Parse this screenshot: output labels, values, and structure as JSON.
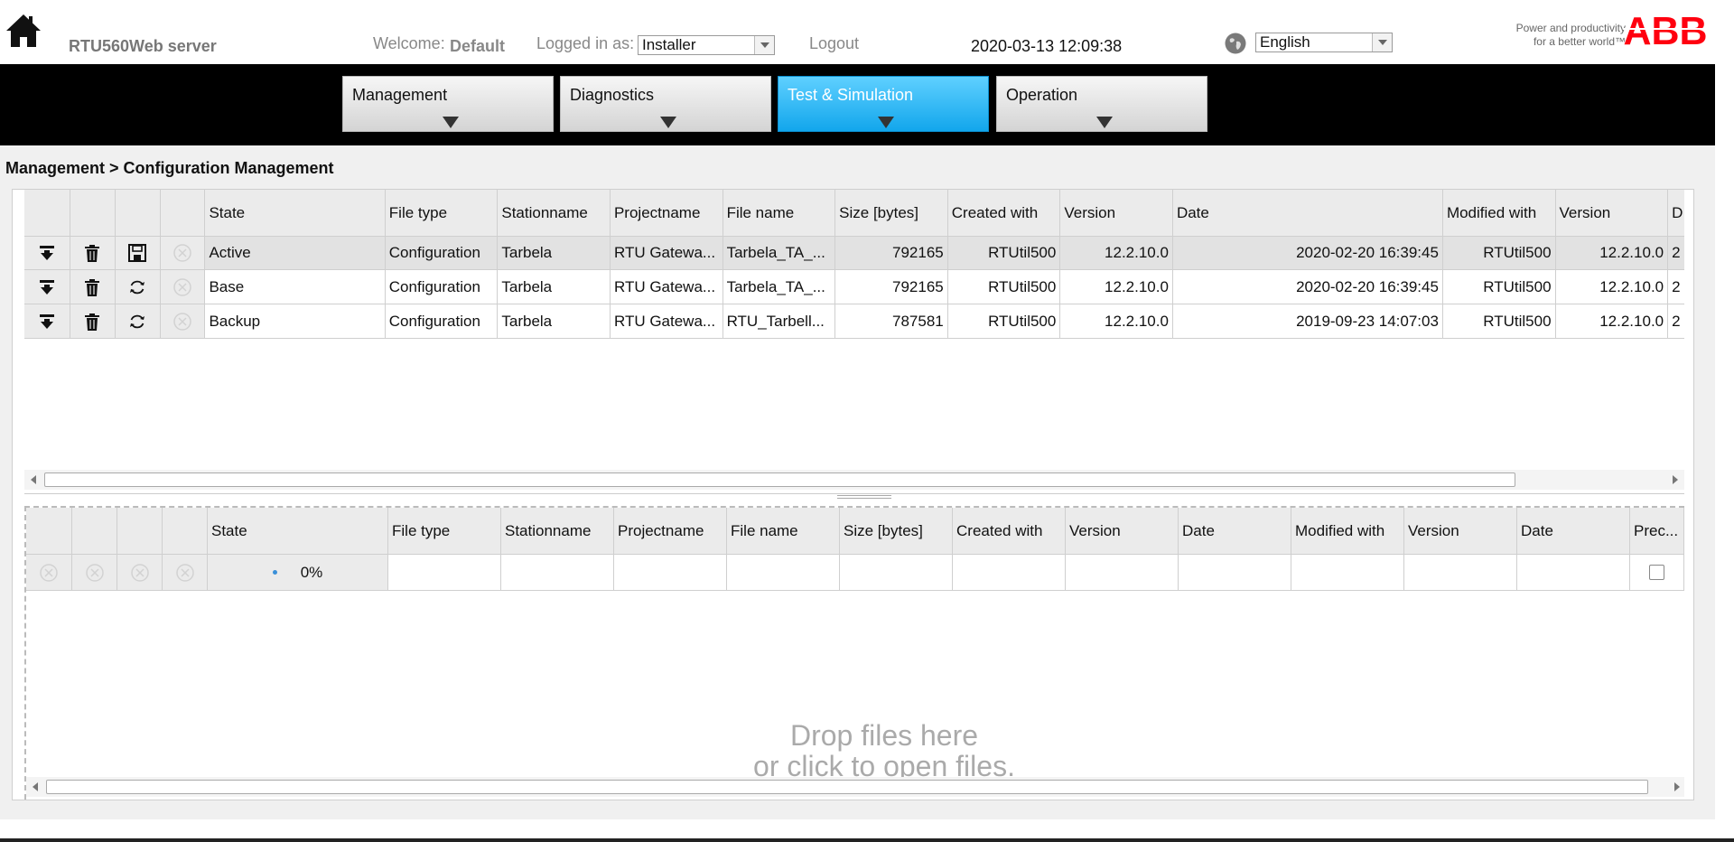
{
  "header": {
    "server_name": "RTU560Web server",
    "welcome_label": "Welcome:",
    "welcome_user": "Default",
    "logged_in_label": "Logged in as:",
    "role_selected": "Installer",
    "logout": "Logout",
    "datetime": "2020-03-13 12:09:38",
    "language_selected": "English",
    "tagline_line1": "Power and productivity",
    "tagline_line2": "for a better world™",
    "logo_text": "ABB"
  },
  "nav": {
    "tabs": [
      {
        "label": "Management",
        "active": false
      },
      {
        "label": "Diagnostics",
        "active": false
      },
      {
        "label": "Test & Simulation",
        "active": true
      },
      {
        "label": "Operation",
        "active": false
      }
    ]
  },
  "breadcrumb": "Management > Configuration Management",
  "top_grid": {
    "headers": [
      "State",
      "File type",
      "Stationname",
      "Projectname",
      "File name",
      "Size [bytes]",
      "Created with",
      "Version",
      "Date",
      "Modified with",
      "Version",
      "D"
    ],
    "rows": [
      {
        "state": "Active",
        "file_type": "Configuration",
        "station": "Tarbela",
        "project": "RTU Gatewa...",
        "file_name": "Tarbela_TA_...",
        "size": "792165",
        "created_with": "RTUtil500",
        "version": "12.2.10.0",
        "date": "2020-02-20 16:39:45",
        "modified_with": "RTUtil500",
        "mod_version": "12.2.10.0",
        "extra": "2",
        "third_icon": "save-icon",
        "selected": true
      },
      {
        "state": "Base",
        "file_type": "Configuration",
        "station": "Tarbela",
        "project": "RTU Gatewa...",
        "file_name": "Tarbela_TA_...",
        "size": "792165",
        "created_with": "RTUtil500",
        "version": "12.2.10.0",
        "date": "2020-02-20 16:39:45",
        "modified_with": "RTUtil500",
        "mod_version": "12.2.10.0",
        "extra": "2",
        "third_icon": "refresh-icon",
        "selected": false
      },
      {
        "state": "Backup",
        "file_type": "Configuration",
        "station": "Tarbela",
        "project": "RTU Gatewa...",
        "file_name": "RTU_Tarbell...",
        "size": "787581",
        "created_with": "RTUtil500",
        "version": "12.2.10.0",
        "date": "2019-09-23 14:07:03",
        "modified_with": "RTUtil500",
        "mod_version": "12.2.10.0",
        "extra": "2",
        "third_icon": "refresh-icon",
        "selected": false
      }
    ]
  },
  "upload_grid": {
    "headers": [
      "State",
      "File type",
      "Stationname",
      "Projectname",
      "File name",
      "Size [bytes]",
      "Created with",
      "Version",
      "Date",
      "Modified with",
      "Version",
      "Date",
      "Prec..."
    ],
    "row": {
      "progress": "0%"
    },
    "dropzone_line1": "Drop files here",
    "dropzone_line2": "or click to open files."
  },
  "colors": {
    "active_tab": "#12a6ec",
    "abb_red": "#ff000f",
    "navbar": "#000000"
  }
}
